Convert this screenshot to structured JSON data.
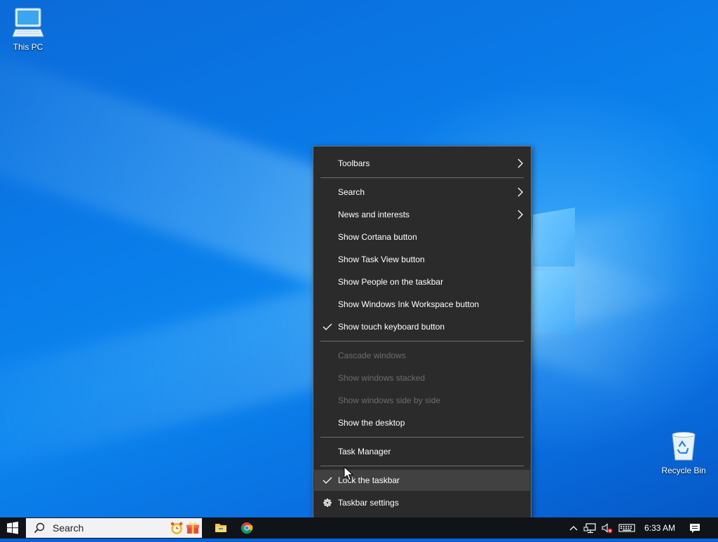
{
  "desktop": {
    "icons": [
      {
        "label": "This PC"
      },
      {
        "label": "Recycle Bin"
      }
    ]
  },
  "context_menu": {
    "items": [
      {
        "label": "Toolbars",
        "submenu": true
      },
      {
        "label": "Search",
        "submenu": true
      },
      {
        "label": "News and interests",
        "submenu": true
      },
      {
        "label": "Show Cortana button"
      },
      {
        "label": "Show Task View button"
      },
      {
        "label": "Show People on the taskbar"
      },
      {
        "label": "Show Windows Ink Workspace button"
      },
      {
        "label": "Show touch keyboard button",
        "checked": true
      },
      {
        "label": "Cascade windows",
        "disabled": true
      },
      {
        "label": "Show windows stacked",
        "disabled": true
      },
      {
        "label": "Show windows side by side",
        "disabled": true
      },
      {
        "label": "Show the desktop"
      },
      {
        "label": "Task Manager"
      },
      {
        "label": "Lock the taskbar",
        "checked": true,
        "hovered": true
      },
      {
        "label": "Taskbar settings",
        "icon": "gear-icon"
      }
    ]
  },
  "taskbar": {
    "search_placeholder": "Search",
    "pinned": [
      "file-explorer-icon",
      "chrome-icon"
    ],
    "tray_icons": [
      "chevron-up-icon",
      "network-icon",
      "volume-muted-icon",
      "keyboard-icon"
    ],
    "clock": "6:33 AM",
    "notifications_icon": "action-center-icon"
  },
  "colors": {
    "menu_bg": "#2b2b2b",
    "menu_hover": "#414141",
    "menu_disabled_text": "#6d6d6d",
    "taskbar_bg": "#101418"
  }
}
